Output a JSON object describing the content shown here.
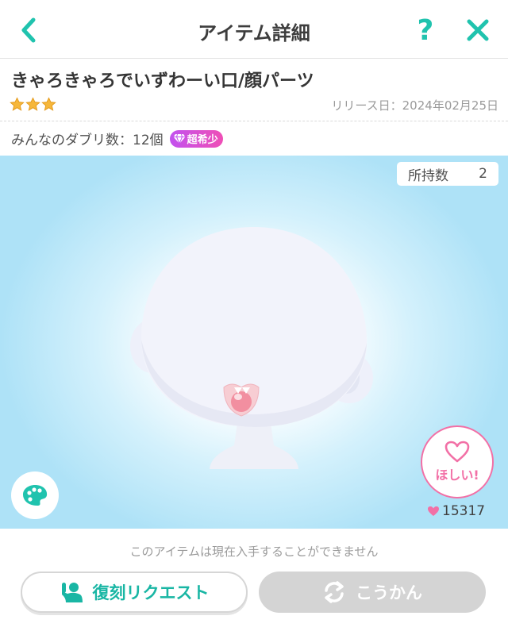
{
  "header": {
    "title": "アイテム詳細",
    "back_icon": "chevron-left-icon",
    "help_label": "?",
    "close_icon": "close-icon"
  },
  "item": {
    "name": "きゃろきゃろでいずわーい口/顔パーツ",
    "stars": 3,
    "release_label": "リリース日：2024年02月25日",
    "duplicate_label": "みんなのダブリ数：12個",
    "rarity_label": "超希少"
  },
  "preview": {
    "owned_label": "所持数",
    "owned_count": "2",
    "want_label": "ほしい!",
    "likes_count": "15317"
  },
  "footer": {
    "notice": "このアイテムは現在入手することができません",
    "revive_label": "復刻リクエスト",
    "trade_label": "こうかん"
  },
  "colors": {
    "accent": "#20c3ae",
    "pink": "#f270a6",
    "star": "#f6b73a",
    "disabled": "#d4d4d4"
  }
}
